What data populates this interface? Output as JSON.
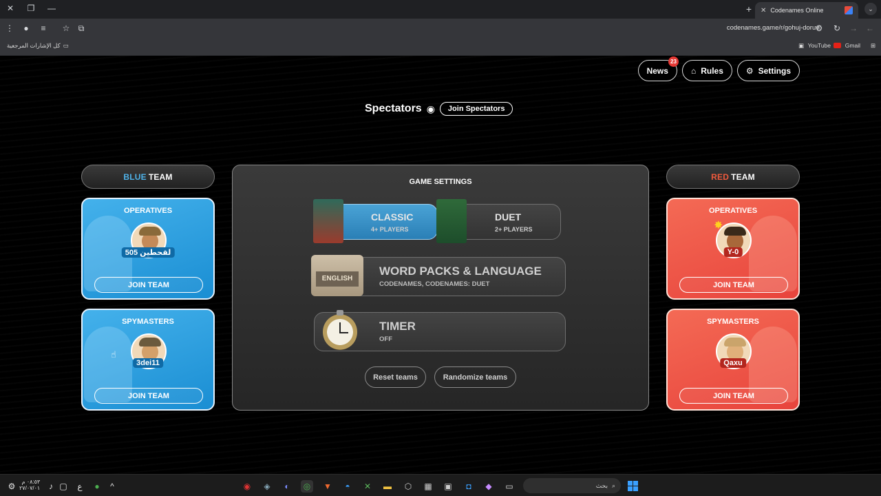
{
  "browser": {
    "tab_title": "Codenames Online",
    "url": "codenames.game/r/gohuj-doruv",
    "bookmarks_all": "كل الإشارات المرجعية",
    "bookmark_youtube": "YouTube",
    "bookmark_gmail": "Gmail"
  },
  "header": {
    "news_label": "News",
    "news_badge": "23",
    "rules_label": "Rules",
    "settings_label": "Settings"
  },
  "spectators": {
    "title": "Spectators",
    "join_label": "Join Spectators"
  },
  "blue_team": {
    "title_highlight": "BLUE",
    "title_rest": "TEAM",
    "operatives": {
      "title": "OPERATIVES",
      "player": "505 لقحطين",
      "join": "JOIN TEAM"
    },
    "spymasters": {
      "title": "SPYMASTERS",
      "player": "3dei11",
      "join": "JOIN TEAM"
    }
  },
  "red_team": {
    "title_highlight": "RED",
    "title_rest": "TEAM",
    "operatives": {
      "title": "OPERATIVES",
      "player": "Y-0",
      "join": "JOIN TEAM"
    },
    "spymasters": {
      "title": "SPYMASTERS",
      "player": "Qaxu",
      "join": "JOIN TEAM"
    }
  },
  "game_settings": {
    "title": "GAME SETTINGS",
    "modes": [
      {
        "title": "CLASSIC",
        "subtitle": "4+ PLAYERS",
        "selected": true
      },
      {
        "title": "DUET",
        "subtitle": "2+ PLAYERS",
        "selected": false
      }
    ],
    "word_packs": {
      "box_label": "ENGLISH",
      "title": "WORD PACKS & LANGUAGE",
      "subtitle": "CODENAMES, CODENAMES: DUET"
    },
    "timer": {
      "title": "TIMER",
      "subtitle": "OFF"
    },
    "reset_label": "Reset teams",
    "randomize_label": "Randomize teams"
  },
  "taskbar": {
    "search_placeholder": "بحث",
    "time": "٠٨:٥٣ م",
    "date": "٢٧/٠٧/٠١",
    "lang": "ع"
  },
  "colors": {
    "blue_accent": "#4fb3ea",
    "red_accent": "#f05a3d",
    "badge": "#e53935"
  }
}
